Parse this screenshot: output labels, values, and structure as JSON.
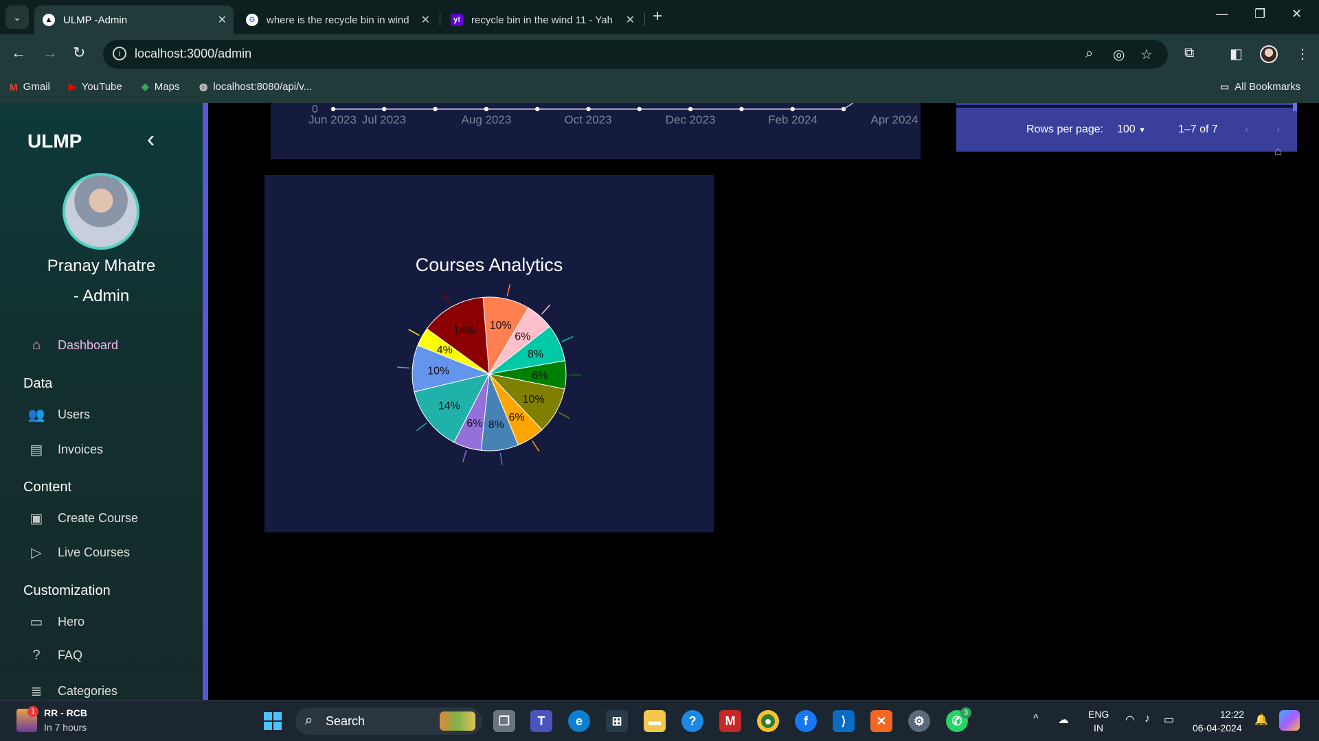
{
  "browser": {
    "tabs": [
      {
        "title": "ULMP -Admin",
        "active": true
      },
      {
        "title": "where is the recycle bin in wind",
        "active": false
      },
      {
        "title": "recycle bin in the wind 11 - Yah",
        "active": false
      }
    ],
    "url": "localhost:3000/admin",
    "bookmarks": [
      "Gmail",
      "YouTube",
      "Maps",
      "localhost:8080/api/v..."
    ],
    "all_bookmarks": "All Bookmarks"
  },
  "sidebar": {
    "brand": "ULMP",
    "user_name": "Pranay Mhatre",
    "user_role": "- Admin",
    "dashboard": "Dashboard",
    "section_data": "Data",
    "users": "Users",
    "invoices": "Invoices",
    "section_content": "Content",
    "create_course": "Create Course",
    "live_courses": "Live Courses",
    "section_customization": "Customization",
    "hero": "Hero",
    "faq": "FAQ",
    "categories": "Categories"
  },
  "line_chart": {
    "y_tick": "0",
    "x_ticks": [
      "Jun 2023",
      "Jul 2023",
      "Aug 2023",
      "Oct 2023",
      "Dec 2023",
      "Feb 2024",
      "Apr 2024"
    ]
  },
  "table": {
    "rows_per_page_label": "Rows per page:",
    "rows_per_page": "100",
    "range": "1–7 of 7"
  },
  "chart_data": {
    "type": "pie",
    "title": "Courses Analytics",
    "slices": [
      {
        "value": 10,
        "label": "10%",
        "color": "#ff7f50"
      },
      {
        "value": 6,
        "label": "6%",
        "color": "#ffc0cb"
      },
      {
        "value": 8,
        "label": "8%",
        "color": "#00c9a7"
      },
      {
        "value": 6,
        "label": "6%",
        "color": "#008000"
      },
      {
        "value": 10,
        "label": "10%",
        "color": "#808000"
      },
      {
        "value": 6,
        "label": "6%",
        "color": "#ffa500"
      },
      {
        "value": 8,
        "label": "8%",
        "color": "#4682b4"
      },
      {
        "value": 6,
        "label": "6%",
        "color": "#9370db"
      },
      {
        "value": 14,
        "label": "14%",
        "color": "#20b2aa"
      },
      {
        "value": 10,
        "label": "10%",
        "color": "#6495ed"
      },
      {
        "value": 4,
        "label": "4%",
        "color": "#ffff00"
      },
      {
        "value": 14,
        "label": "14%",
        "color": "#8b0000"
      }
    ]
  },
  "taskbar": {
    "weather_title": "RR - RCB",
    "weather_sub": "In 7 hours",
    "weather_badge": "1",
    "search": "Search",
    "whatsapp_badge": "3",
    "lang": "ENG",
    "region": "IN",
    "time": "12:22",
    "date": "06-04-2024"
  }
}
